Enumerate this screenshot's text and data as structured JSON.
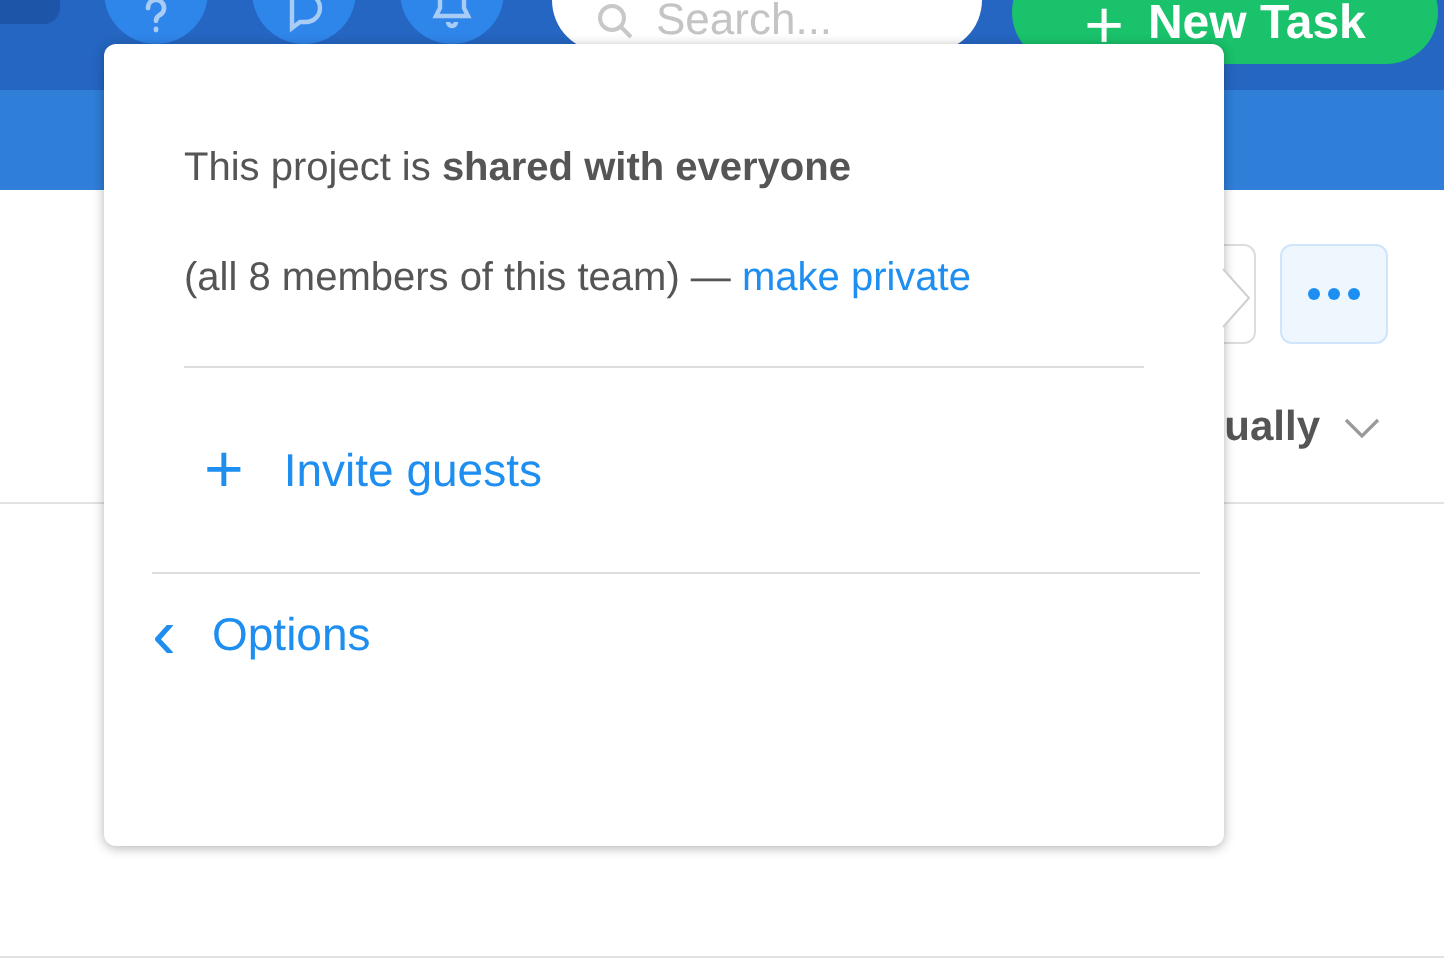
{
  "top_bar": {
    "search": {
      "placeholder": "Search..."
    },
    "new_task_button": {
      "icon": "+",
      "label": "New Task"
    }
  },
  "toolbar": {
    "sort_label": "ually"
  },
  "popover": {
    "sharing_text": "This project is **shared with everyone**",
    "members_text": "(all 8 members of this team) —",
    "make_private_link": "make private",
    "invite": {
      "icon": "+",
      "label": "Invite guests"
    },
    "back": {
      "icon": "‹",
      "label": "Options"
    }
  }
}
